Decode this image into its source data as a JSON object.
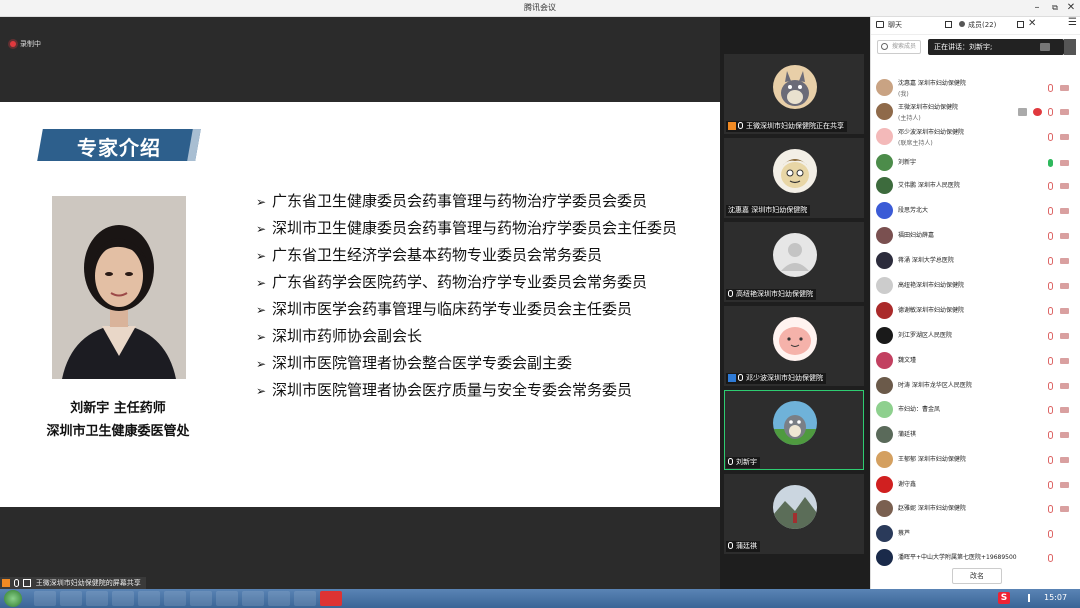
{
  "window": {
    "title": "腾讯会议",
    "minimize": "–",
    "maximize": "⧉",
    "close": "✕"
  },
  "stage": {
    "recording_label": "录制中",
    "share_label": "王微深圳市妇幼保健院的屏幕共享"
  },
  "slide": {
    "banner": "专家介绍",
    "caption_line1": "刘新宇  主任药师",
    "caption_line2": "深圳市卫生健康委医管处",
    "bullet_marker": "➢",
    "bullets": [
      "广东省卫生健康委员会药事管理与药物治疗学委员会委员",
      "深圳市卫生健康委员会药事管理与药物治疗学委员会主任委员",
      "广东省卫生经济学会基本药物专业委员会常务委员",
      "广东省药学会医院药学、药物治疗学专业委员会常务委员",
      "深圳市医学会药事管理与临床药学专业委员会主任委员",
      "深圳市药师协会副会长",
      "深圳市医院管理者协会整合医学专委会副主委",
      "深圳市医院管理者协会医疗质量与安全专委会常务委员"
    ]
  },
  "tiles": [
    {
      "name": "王微深圳市妇幼保健院正在共享",
      "avatar": "totoro-avatar"
    },
    {
      "name": "沈惠嘉  深圳市妇幼保健院",
      "avatar": "cartoon-avatar"
    },
    {
      "name": "高纽艳深圳市妇幼保健院",
      "avatar": "default-avatar"
    },
    {
      "name": "邓少波深圳市妇幼保健院",
      "avatar": "pink-avatar"
    },
    {
      "name": "刘新宇",
      "avatar": "totoro-green-avatar"
    },
    {
      "name": "蒲廷祺",
      "avatar": "landscape-avatar"
    }
  ],
  "panel": {
    "chat_tab": "聊天",
    "members_tab": "成员(22)",
    "search_placeholder": "搜索成员",
    "speaking_label": "正在讲话：刘新宇;",
    "rename_button": "改名",
    "members": [
      {
        "name": "沈惠嘉 深圳市妇幼保健院",
        "role": "(我)",
        "color": "#c9a383"
      },
      {
        "name": "王微深圳市妇幼保健院",
        "role": "(主持人)",
        "color": "#8f6a4a"
      },
      {
        "name": "邓少波深圳市妇幼保健院",
        "role": "(联席主持人)",
        "color": "#f3b9b9"
      },
      {
        "name": "刘新宇",
        "role": "",
        "color": "#4c8c4a"
      },
      {
        "name": "艾伟鹏 深圳市人民医院",
        "role": "",
        "color": "#3d6b3d"
      },
      {
        "name": "段思芳北大",
        "role": "",
        "color": "#3b5bd6"
      },
      {
        "name": "福田妇幼薛嘉",
        "role": "",
        "color": "#7a5050"
      },
      {
        "name": "蒋涌 深圳大学总医院",
        "role": "",
        "color": "#2c2c3c"
      },
      {
        "name": "高纽艳深圳市妇幼保健院",
        "role": "",
        "color": "#cccccc"
      },
      {
        "name": "德谢敏深圳市妇幼保健院",
        "role": "",
        "color": "#aa2a2a"
      },
      {
        "name": "刘江罗湖区人民医院",
        "role": "",
        "color": "#1a1a1a"
      },
      {
        "name": "魏文瑾",
        "role": "",
        "color": "#c24060"
      },
      {
        "name": "时涛 深圳市龙华区人民医院",
        "role": "",
        "color": "#6b5a4a"
      },
      {
        "name": "市妇幼：曹金凤",
        "role": "",
        "color": "#8ed08e"
      },
      {
        "name": "蒲廷祺",
        "role": "",
        "color": "#5a6a5a"
      },
      {
        "name": "王郁郁 深圳市妇幼保健院",
        "role": "",
        "color": "#d4a060"
      },
      {
        "name": "谢守鑫",
        "role": "",
        "color": "#d02020"
      },
      {
        "name": "赵雅妮 深圳市妇幼保健院",
        "role": "",
        "color": "#7a6050"
      },
      {
        "name": "蔡芦",
        "role": "",
        "color": "#2a3a5a"
      },
      {
        "name": "潘晖平+中山大学附属第七医院+19689500",
        "role": "",
        "color": "#1a2a4a"
      }
    ]
  },
  "taskbar": {
    "clock": "15:07",
    "ime": "S"
  }
}
